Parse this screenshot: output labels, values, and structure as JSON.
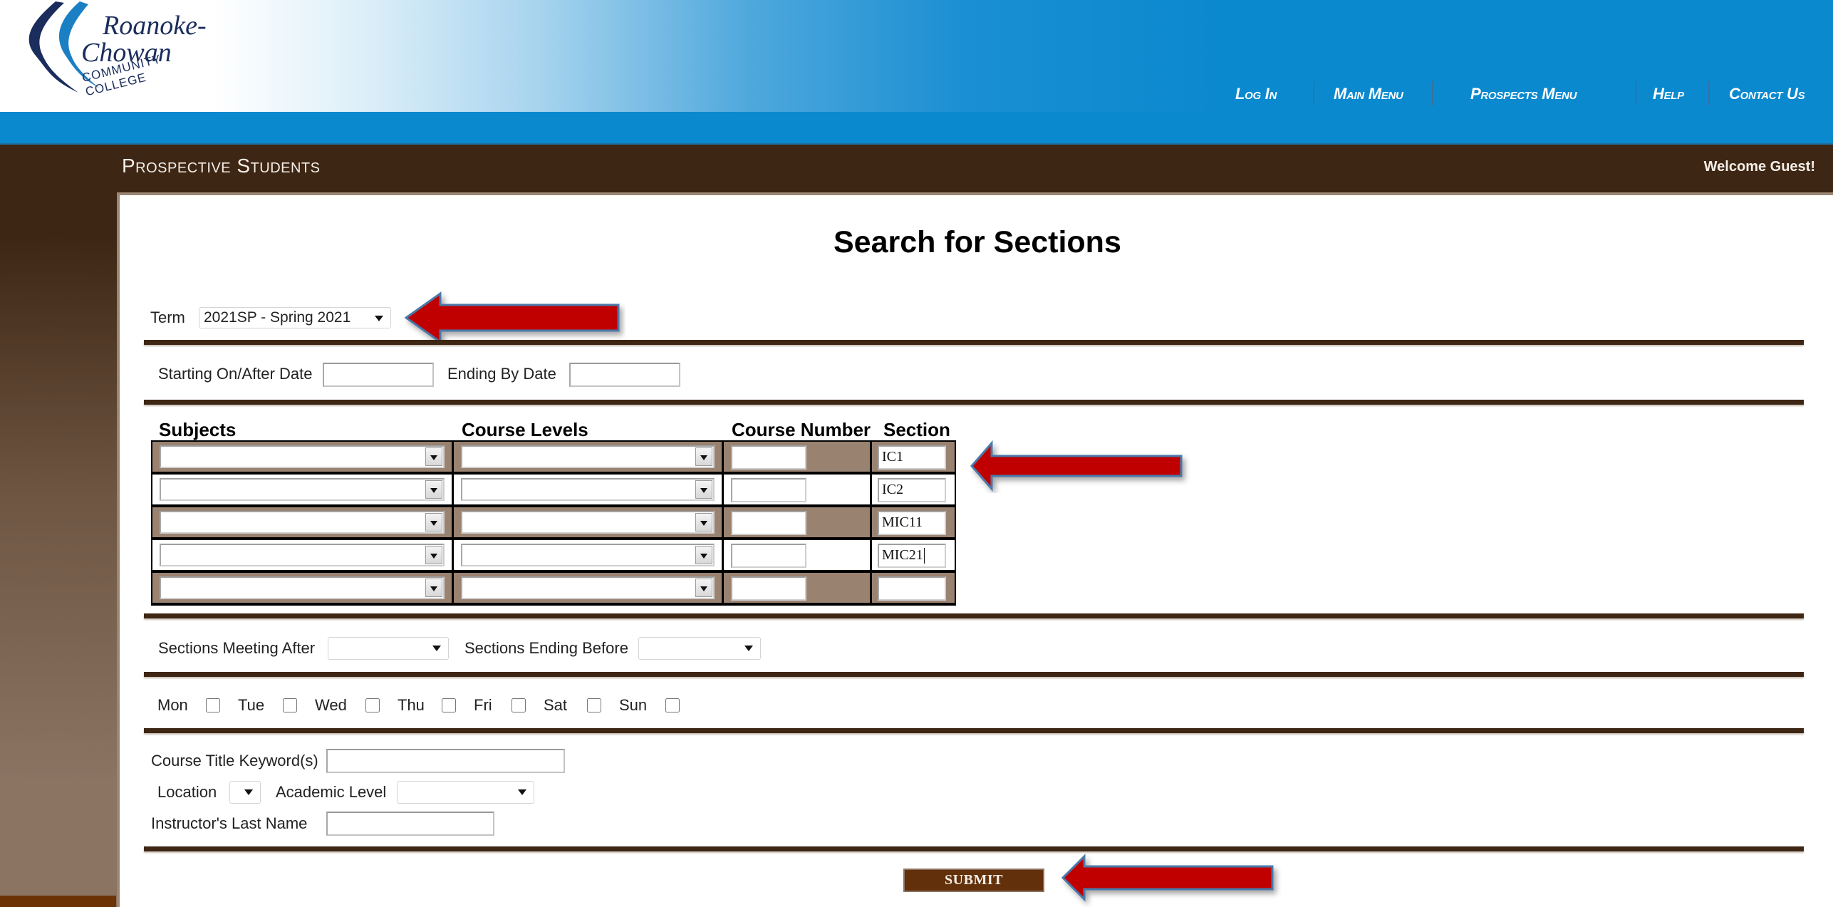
{
  "header": {
    "logo": {
      "line1": "Roanoke-",
      "line2": "Chowan",
      "tagline": "COMMUNITY COLLEGE"
    },
    "nav": [
      {
        "label": "Log In"
      },
      {
        "label": "Main Menu"
      },
      {
        "label": "Prospects Menu"
      },
      {
        "label": "Help"
      },
      {
        "label": "Contact Us"
      }
    ]
  },
  "titlebar": {
    "section": "Prospective Students",
    "welcome": "Welcome Guest!"
  },
  "form": {
    "title": "Search for Sections",
    "term": {
      "label": "Term",
      "value": "2021SP - Spring 2021"
    },
    "dates": {
      "start_label": "Starting On/After Date",
      "start_value": "",
      "end_label": "Ending By Date",
      "end_value": ""
    },
    "course_table": {
      "headers": [
        "Subjects",
        "Course Levels",
        "Course Number",
        "Section"
      ],
      "rows": [
        {
          "subject": "",
          "level": "",
          "number": "",
          "section": "IC1"
        },
        {
          "subject": "",
          "level": "",
          "number": "",
          "section": "IC2"
        },
        {
          "subject": "",
          "level": "",
          "number": "",
          "section": "MIC11"
        },
        {
          "subject": "",
          "level": "",
          "number": "",
          "section": "MIC21"
        },
        {
          "subject": "",
          "level": "",
          "number": "",
          "section": ""
        }
      ]
    },
    "times": {
      "after_label": "Sections Meeting After",
      "after_value": "",
      "before_label": "Sections Ending Before",
      "before_value": ""
    },
    "days": [
      {
        "label": "Mon",
        "checked": false
      },
      {
        "label": "Tue",
        "checked": false
      },
      {
        "label": "Wed",
        "checked": false
      },
      {
        "label": "Thu",
        "checked": false
      },
      {
        "label": "Fri",
        "checked": false
      },
      {
        "label": "Sat",
        "checked": false
      },
      {
        "label": "Sun",
        "checked": false
      }
    ],
    "keyword": {
      "label": "Course Title Keyword(s)",
      "value": ""
    },
    "location": {
      "label": "Location",
      "value": ""
    },
    "academic_level": {
      "label": "Academic Level",
      "value": ""
    },
    "instructor": {
      "label": "Instructor's Last Name",
      "value": ""
    },
    "submit_label": "SUBMIT"
  },
  "annotations": {
    "arrow_color": "#c00000",
    "arrow_outline": "#4a79aa",
    "arrows": [
      "points-to-term",
      "points-to-section",
      "points-to-submit"
    ]
  }
}
